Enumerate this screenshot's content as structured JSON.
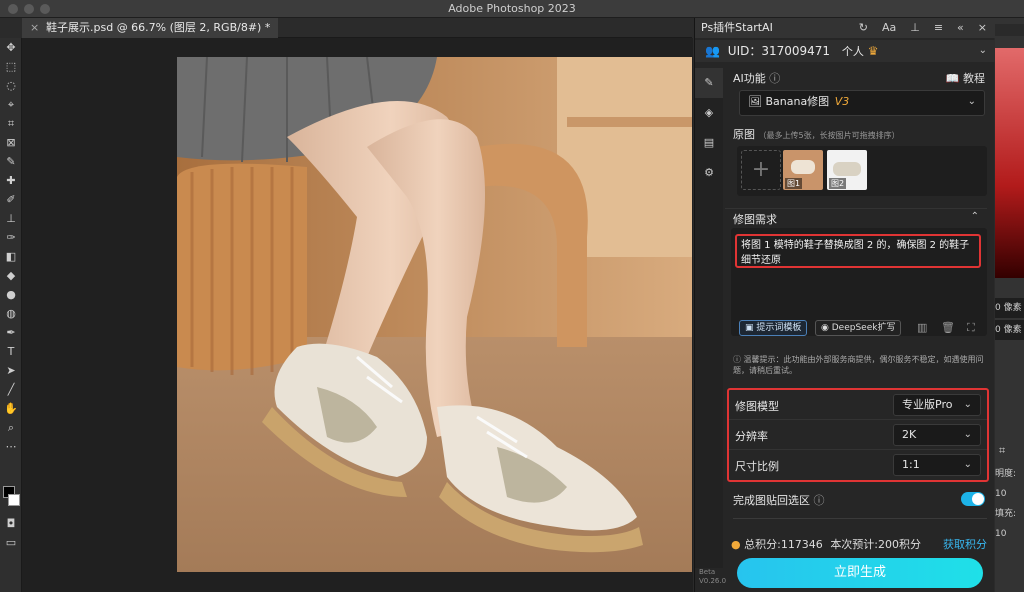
{
  "app": {
    "title": "Adobe Photoshop 2023"
  },
  "document": {
    "tab_title": "鞋子展示.psd @ 66.7% (图层 2, RGB/8#) *",
    "close": "×"
  },
  "panel": {
    "title": "Ps插件StartAI",
    "uid": "UID：317009471",
    "account_type": "个人",
    "ai_function_label": "AI功能",
    "tutorial": "教程",
    "function_value": "Banana修图",
    "function_badge": "V3",
    "original_label": "原图",
    "original_hint": "（最多上传5张，长按图片可拖拽排序）",
    "thumb1": "图1",
    "thumb2": "图2",
    "requirement_label": "修图需求",
    "requirement_text": "将图 1 模特的鞋子替换成图 2 的，确保图 2 的鞋子细节还原",
    "prompt_template": "提示词模板",
    "deepseek": "DeepSeek扩写",
    "notice": "温馨提示：此功能由外部服务商提供，偶尔服务不稳定，如遇使用问题，请稍后重试。",
    "model_label": "修图模型",
    "model_value": "专业版Pro",
    "resolution_label": "分辨率",
    "resolution_value": "2K",
    "ratio_label": "尺寸比例",
    "ratio_value": "1:1",
    "paste_back_label": "完成图贴回选区",
    "points_total": "总积分:117346",
    "points_estimate": "本次预计:200积分",
    "get_points": "获取积分",
    "generate": "立即生成",
    "beta": "Beta",
    "version": "V0.26.0"
  },
  "right_strip": {
    "px1": "0 像素",
    "px2": "0 像素",
    "opacity": "明度: 10",
    "fill": "填充: 10"
  },
  "colors": {
    "accent": "#27c4ee",
    "highlight": "#e03434",
    "badge": "#f0a93a"
  }
}
